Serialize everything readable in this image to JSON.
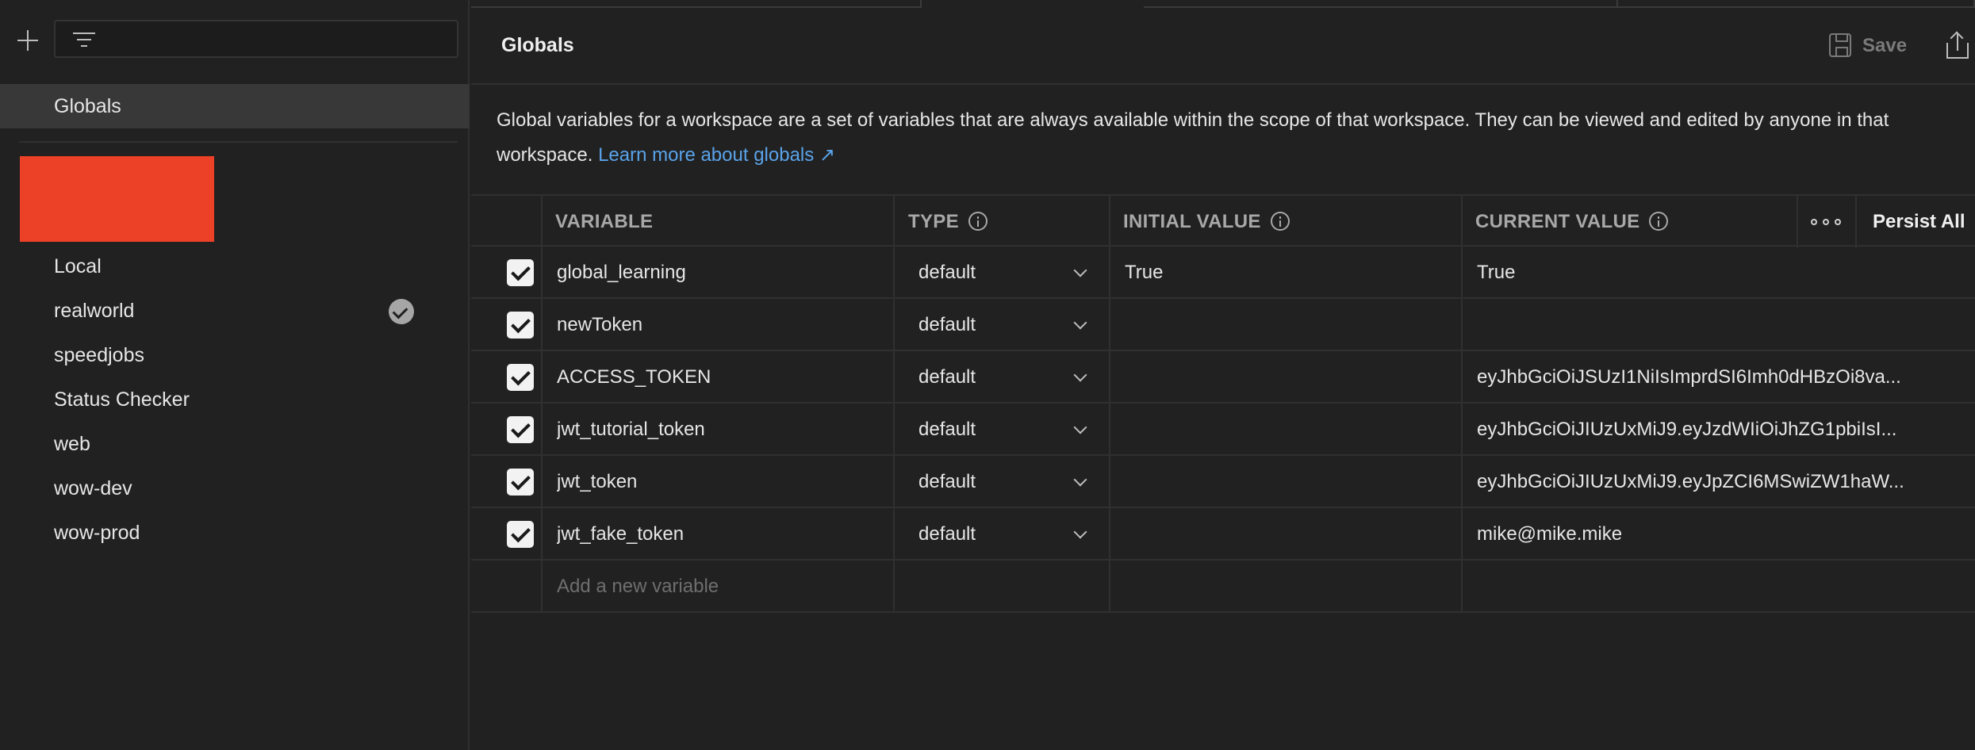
{
  "sidebar": {
    "search_placeholder": "",
    "selected": "Globals",
    "environments": [
      {
        "label": "Local",
        "active": false
      },
      {
        "label": "realworld",
        "active": true
      },
      {
        "label": "speedjobs",
        "active": false
      },
      {
        "label": "Status Checker",
        "active": false
      },
      {
        "label": "web",
        "active": false
      },
      {
        "label": "wow-dev",
        "active": false
      },
      {
        "label": "wow-prod",
        "active": false
      }
    ]
  },
  "header": {
    "title": "Globals",
    "save_label": "Save"
  },
  "description": {
    "text": "Global variables for a workspace are a set of variables that are always available within the scope of that workspace. They can be viewed and edited by anyone in that",
    "text2": "workspace.",
    "link": "Learn more about globals ↗"
  },
  "table": {
    "headers": {
      "variable": "VARIABLE",
      "type": "TYPE",
      "initial": "INITIAL VALUE",
      "current": "CURRENT VALUE",
      "persist": "Persist All"
    },
    "rows": [
      {
        "name": "global_learning",
        "type": "default",
        "initial": "True",
        "current": "True"
      },
      {
        "name": "newToken",
        "type": "default",
        "initial": "",
        "current": ""
      },
      {
        "name": "ACCESS_TOKEN",
        "type": "default",
        "initial": "",
        "current": "eyJhbGciOiJSUzI1NiIsImprdSI6Imh0dHBzOi8va..."
      },
      {
        "name": "jwt_tutorial_token",
        "type": "default",
        "initial": "",
        "current": "eyJhbGciOiJIUzUxMiJ9.eyJzdWIiOiJhZG1pbiIsI..."
      },
      {
        "name": "jwt_token",
        "type": "default",
        "initial": "",
        "current": "eyJhbGciOiJIUzUxMiJ9.eyJpZCI6MSwiZW1haW..."
      },
      {
        "name": "jwt_fake_token",
        "type": "default",
        "initial": "",
        "current": "mike@mike.mike"
      }
    ],
    "add_placeholder": "Add a new variable"
  },
  "colors": {
    "background": "#212121",
    "selected_row": "#383838",
    "link": "#5aa3ea",
    "redaction": "#ed4127"
  }
}
